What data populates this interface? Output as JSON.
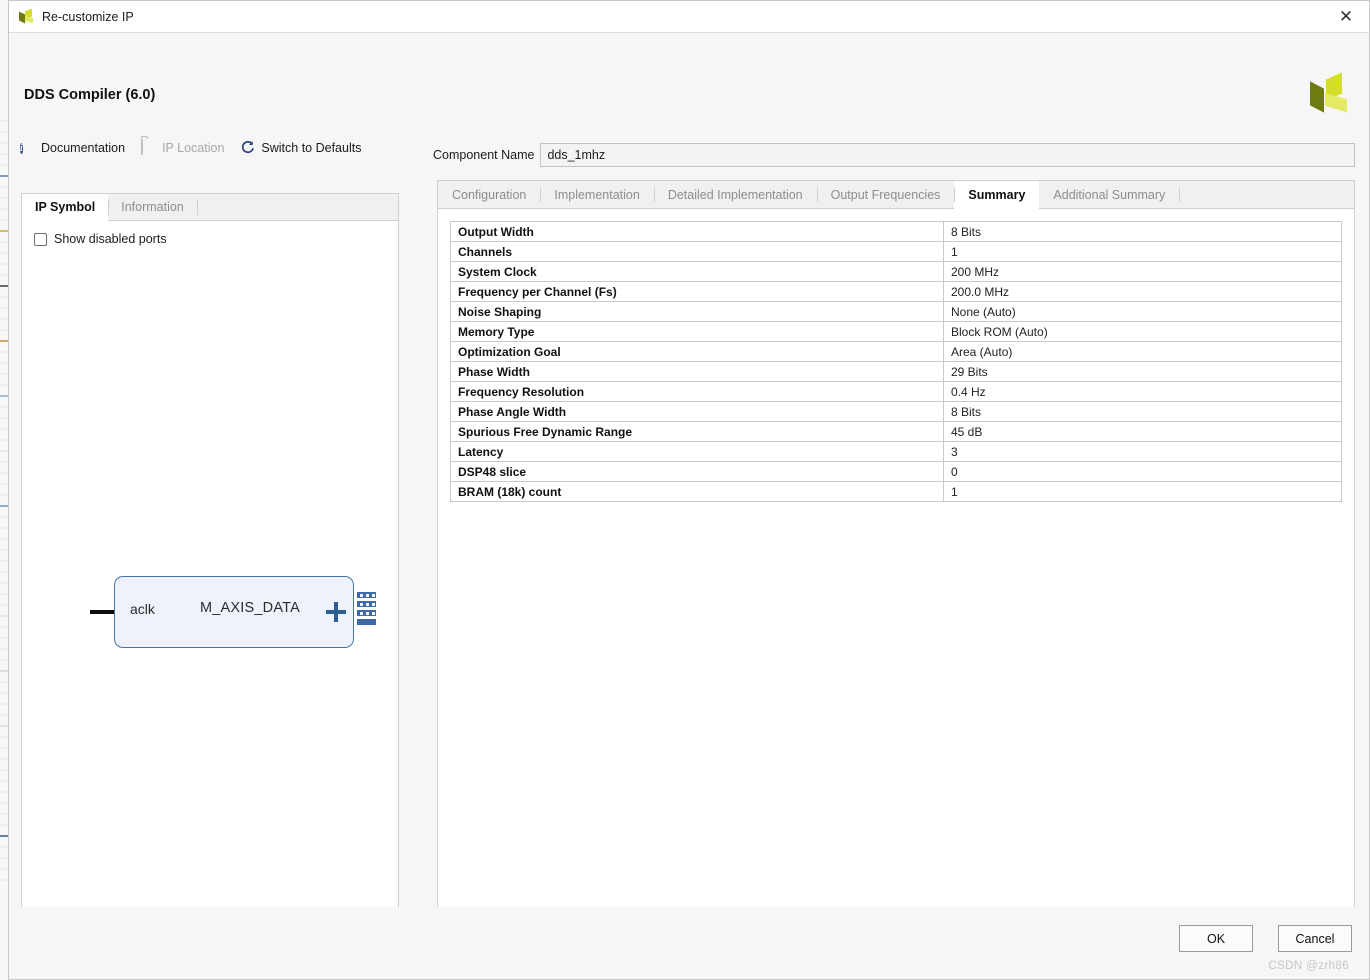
{
  "window": {
    "title": "Re-customize IP",
    "close_icon": "close-icon",
    "app_icon": "xilinx-logo-icon"
  },
  "header": {
    "ip_title": "DDS Compiler (6.0)",
    "logo_icon": "xilinx-logo-icon",
    "toolbar": [
      {
        "label": "Documentation",
        "icon": "info-icon",
        "disabled": false
      },
      {
        "label": "IP Location",
        "icon": "folder-icon",
        "disabled": true
      },
      {
        "label": "Switch to Defaults",
        "icon": "refresh-icon",
        "disabled": false
      }
    ]
  },
  "left_panel": {
    "tabs": [
      {
        "label": "IP Symbol",
        "active": true
      },
      {
        "label": "Information",
        "active": false
      }
    ],
    "show_disabled_ports": {
      "label": "Show disabled ports",
      "checked": false
    },
    "symbol": {
      "clock_port": "aclk",
      "data_port": "M_AXIS_DATA",
      "expand_icon": "plus-icon",
      "bus_icon": "bus-connector-icon"
    }
  },
  "component": {
    "label": "Component Name",
    "value": "dds_1mhz",
    "placeholder": "Component Name"
  },
  "main_tabs": [
    {
      "label": "Configuration",
      "active": false
    },
    {
      "label": "Implementation",
      "active": false
    },
    {
      "label": "Detailed Implementation",
      "active": false
    },
    {
      "label": "Output Frequencies",
      "active": false
    },
    {
      "label": "Summary",
      "active": true
    },
    {
      "label": "Additional Summary",
      "active": false
    }
  ],
  "summary": {
    "rows": [
      {
        "key": "Output Width",
        "value": "8 Bits"
      },
      {
        "key": "Channels",
        "value": "1"
      },
      {
        "key": "System Clock",
        "value": "200 MHz"
      },
      {
        "key": "Frequency per Channel (Fs)",
        "value": "200.0 MHz"
      },
      {
        "key": "Noise Shaping",
        "value": "None (Auto)"
      },
      {
        "key": "Memory Type",
        "value": "Block ROM (Auto)"
      },
      {
        "key": "Optimization Goal",
        "value": "Area (Auto)"
      },
      {
        "key": "Phase Width",
        "value": "29 Bits"
      },
      {
        "key": "Frequency Resolution",
        "value": "0.4 Hz"
      },
      {
        "key": "Phase Angle Width",
        "value": "8 Bits"
      },
      {
        "key": "Spurious Free Dynamic Range",
        "value": "45 dB"
      },
      {
        "key": "Latency",
        "value": "3"
      },
      {
        "key": "DSP48 slice",
        "value": "0"
      },
      {
        "key": "BRAM (18k) count",
        "value": "1"
      }
    ]
  },
  "footer": {
    "ok_label": "OK",
    "cancel_label": "Cancel",
    "watermark": "CSDN @zrh86"
  },
  "colors": {
    "accent_blue": "#22437f",
    "symbol_border": "#4a74a8",
    "symbol_fill": "#eef3fb",
    "logo_yellow": "#d4dd2a",
    "logo_olive": "#6f7a10"
  }
}
